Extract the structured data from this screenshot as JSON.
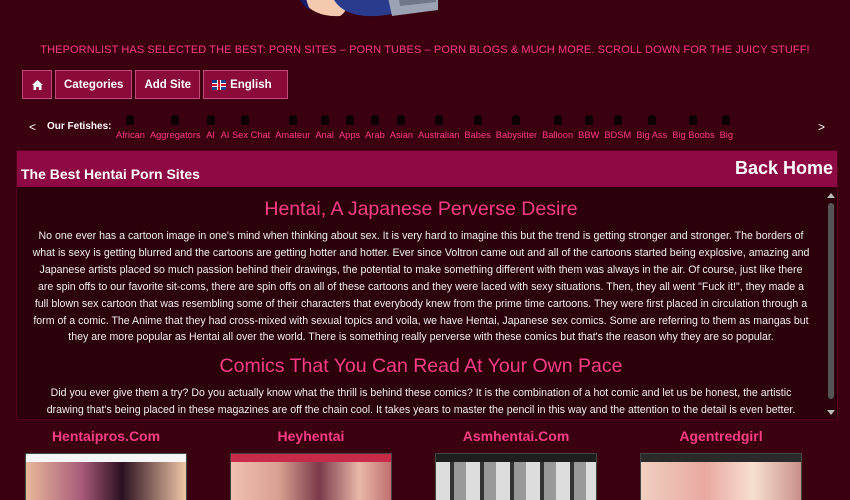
{
  "tagline": "THEPORNLIST HAS SELECTED THE BEST: PORN SITES – PORN TUBES – PORN BLOGS & MUCH MORE. SCROLL DOWN FOR THE JUICY STUFF!",
  "nav": {
    "categories": "Categories",
    "add_site": "Add Site",
    "language": "English"
  },
  "fetishes": {
    "label": "Our Fetishes:",
    "items": [
      "African",
      "Aggregators",
      "AI",
      "AI Sex Chat",
      "Amateur",
      "Anal",
      "Apps",
      "Arab",
      "Asian",
      "Australian",
      "Babes",
      "Babysitter",
      "Balloon",
      "BBW",
      "BDSM",
      "Big Ass",
      "Big Boobs",
      "Big"
    ]
  },
  "panel": {
    "title": "The Best Hentai Porn Sites",
    "back_home": "Back Home",
    "heading1": "Hentai, A Japanese Perverse Desire",
    "para1": "No one ever has a cartoon image in one's mind when thinking about sex. It is very hard to imagine this but the trend is getting stronger and stronger. The borders of what is sexy is getting blurred and the cartoons are getting hotter and hotter. Ever since Voltron came out and all of the cartoons started being explosive, amazing and Japanese artists placed so much passion behind their drawings, the potential to make something different with them was always in the air. Of course, just like there are spin offs to our favorite sit-coms, there are spin offs on all of these cartoons and they were laced with sexy situations. Then, they all went \"Fuck it!\", they made a full blown sex cartoon that was resembling some of their characters that everybody knew from the prime time cartoons. They were first placed in circulation through a form of a comic. The Anime that they had cross-mixed with sexual topics and voila, we have Hentai, Japanese sex comics. Some are referring to them as mangas but they are more popular as Hentai all over the world. There is something really perverse with these comics but that's the reason why they are so popular.",
    "heading2": "Comics That You Can Read At Your Own Pace",
    "para2": "Did you ever give them a try? Do you actually know what the thrill is behind these comics? It is the combination of a hot comic and let us be honest, the artistic drawing that's being placed in these magazines are off the chain cool. It takes years to master the pencil in this way and the attention to the detail is even better."
  },
  "sites": [
    "Hentaipros.Com",
    "Heyhentai",
    "Asmhentai.Com",
    "Agentredgirl"
  ],
  "colors": {
    "background": "#3a0010",
    "accent": "#ff3d86",
    "header": "#8e0844",
    "button": "#8a0a3a"
  }
}
